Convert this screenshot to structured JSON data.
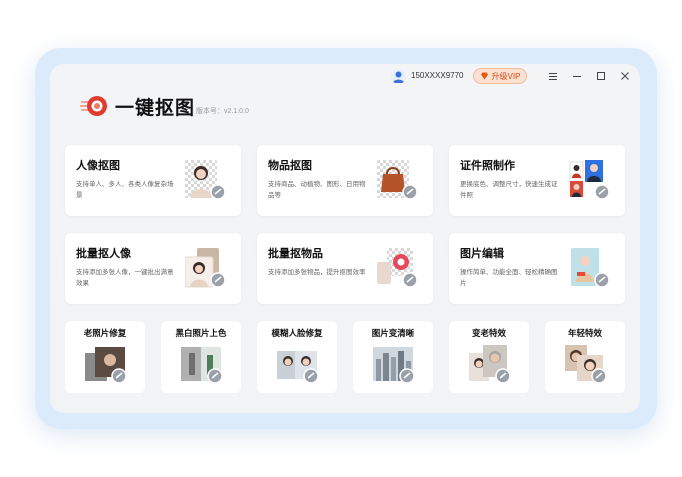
{
  "header": {
    "account": "150XXXX9770",
    "vip_label": "升级VIP",
    "brand": "一键抠图",
    "version": "版本号：v2.1.0.0"
  },
  "features": [
    {
      "title": "人像抠图",
      "desc": "支持单人、多人、各类人像复杂场景"
    },
    {
      "title": "物品抠图",
      "desc": "支持商品、动植物、图形、日用物品等"
    },
    {
      "title": "证件照制作",
      "desc": "更换底色、调整尺寸，快速生成证件照"
    },
    {
      "title": "批量抠人像",
      "desc": "支持添加多张人像，一键批出满意效果"
    },
    {
      "title": "批量抠物品",
      "desc": "支持添加多张物品，提升抠图效率"
    },
    {
      "title": "图片编辑",
      "desc": "操作简单、功能全面、轻松精确图片"
    }
  ],
  "tools": [
    {
      "title": "老照片修复"
    },
    {
      "title": "黑白照片上色"
    },
    {
      "title": "模糊人脸修复"
    },
    {
      "title": "图片变清晰"
    },
    {
      "title": "变老特效"
    },
    {
      "title": "年轻特效"
    }
  ],
  "colors": {
    "accent": "#e03c2e",
    "frame": "#dcebfb",
    "vip_bg": "#fde2d4"
  }
}
